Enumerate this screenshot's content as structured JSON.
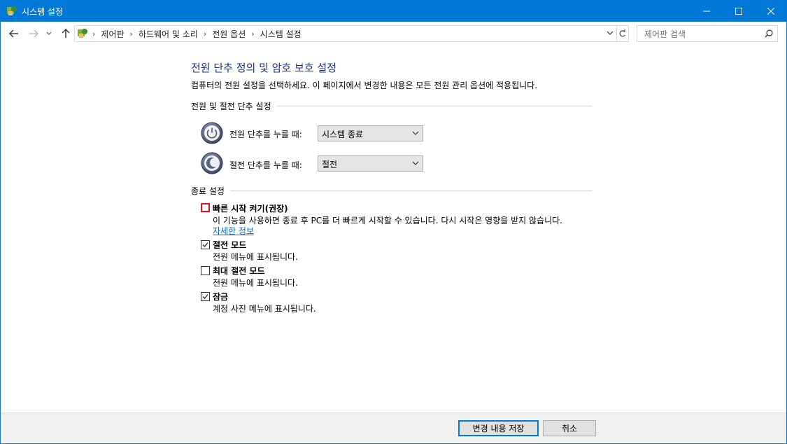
{
  "window": {
    "title": "시스템 설정"
  },
  "address": {
    "crumbs": [
      "제어판",
      "하드웨어 및 소리",
      "전원 옵션",
      "시스템 설정"
    ],
    "search_placeholder": "제어판 검색"
  },
  "main": {
    "title": "전원 단추 정의 및 암호 보호 설정",
    "description": "컴퓨터의 전원 설정을 선택하세요. 이 페이지에서 변경한 내용은 모든 전원 관리 옵션에 적용됩니다.",
    "power_group": {
      "heading": "전원 및 절전 단추 설정",
      "power_button_label": "전원 단추를 누를 때:",
      "power_button_value": "시스템 종료",
      "sleep_button_label": "절전 단추를 누를 때:",
      "sleep_button_value": "절전"
    },
    "shutdown_group": {
      "heading": "종료 설정",
      "options": [
        {
          "title": "빠른 시작 켜기(권장)",
          "desc": "이 기능을 사용하면 종료 후 PC를 더 빠르게 시작할 수 있습니다. 다시 시작은 영향을 받지 않습니다.",
          "link": "자세한 정보",
          "checked": false,
          "highlighted": true
        },
        {
          "title": "절전 모드",
          "desc": "전원 메뉴에 표시됩니다.",
          "checked": true
        },
        {
          "title": "최대 절전 모드",
          "desc": "전원 메뉴에 표시됩니다.",
          "checked": false
        },
        {
          "title": "잠금",
          "desc": "계정 사진 메뉴에 표시됩니다.",
          "checked": true
        }
      ]
    }
  },
  "footer": {
    "save_label": "변경 내용 저장",
    "cancel_label": "취소"
  },
  "colors": {
    "titlebar": "#0078d7",
    "heading": "#1e3287",
    "link": "#0066cc",
    "highlight": "#e81123"
  },
  "icons": [
    "control-panel-icon",
    "minimize-icon",
    "maximize-icon",
    "close-icon",
    "back-arrow-icon",
    "forward-arrow-icon",
    "recent-dropdown-icon",
    "up-arrow-icon",
    "chevron-right-icon",
    "refresh-icon",
    "search-icon",
    "power-button-icon",
    "sleep-button-icon",
    "chevron-down-icon",
    "checkmark-icon"
  ]
}
